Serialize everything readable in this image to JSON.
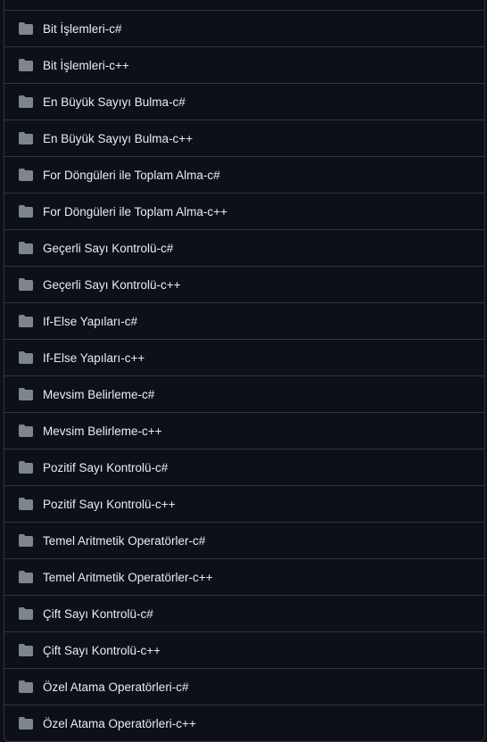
{
  "colors": {
    "background": "#0d1117",
    "border": "#30363d",
    "text": "#e6edf3",
    "folder_icon": "#7d8590"
  },
  "icon": "folder-icon",
  "folders": [
    {
      "name": "Bit İşlemleri-c#"
    },
    {
      "name": "Bit İşlemleri-c++"
    },
    {
      "name": "En Büyük Sayıyı Bulma-c#"
    },
    {
      "name": "En Büyük Sayıyı Bulma-c++"
    },
    {
      "name": "For Döngüleri ile Toplam Alma-c#"
    },
    {
      "name": "For Döngüleri ile Toplam Alma-c++"
    },
    {
      "name": "Geçerli Sayı Kontrolü-c#"
    },
    {
      "name": "Geçerli Sayı Kontrolü-c++"
    },
    {
      "name": "If-Else Yapıları-c#"
    },
    {
      "name": "If-Else Yapıları-c++"
    },
    {
      "name": "Mevsim Belirleme-c#"
    },
    {
      "name": "Mevsim Belirleme-c++"
    },
    {
      "name": "Pozitif Sayı Kontrolü-c#"
    },
    {
      "name": "Pozitif Sayı Kontrolü-c++"
    },
    {
      "name": "Temel Aritmetik Operatörler-c#"
    },
    {
      "name": "Temel Aritmetik Operatörler-c++"
    },
    {
      "name": "Çift Sayı Kontrolü-c#"
    },
    {
      "name": "Çift Sayı Kontrolü-c++"
    },
    {
      "name": "Özel Atama Operatörleri-c#"
    },
    {
      "name": "Özel Atama Operatörleri-c++"
    }
  ]
}
